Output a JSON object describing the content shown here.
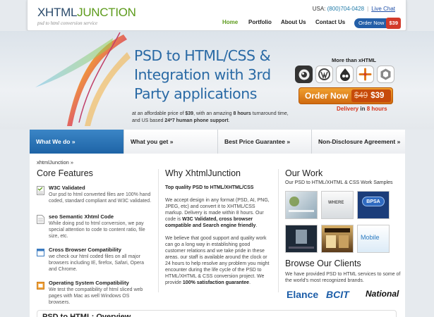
{
  "header": {
    "logo_main": "XHTML",
    "logo_accent": "JUNCTION",
    "logo_tagline": "psd to html conversion service",
    "contact_prefix": "USA:",
    "phone": "(800)704-0428",
    "separator": "|",
    "live_chat": "Live Chat",
    "nav": [
      "Home",
      "Portfolio",
      "About Us",
      "Contact Us"
    ],
    "order_label": "Order Now",
    "order_price": "$39"
  },
  "hero": {
    "title": "PSD to HTML/CSS & Integration with 3rd Party applications",
    "subtitle_start": "at an affordable price of ",
    "subtitle_price": "$39",
    "subtitle_mid": ", with an amazing ",
    "subtitle_hours": "8 hours",
    "subtitle_mid2": " turnaround time, and US based ",
    "subtitle_support": "24*7 human phone support",
    "subtitle_end": ".",
    "more_than": "More than xHTML",
    "cms_icons": [
      "drupal-icon",
      "wordpress-icon",
      "drupal-drop-icon",
      "joomla-icon",
      "magento-icon"
    ],
    "order_label": "Order Now",
    "old_price": "$49",
    "new_price": "$39",
    "delivery_prefix": "Delivery",
    "delivery_in": " in ",
    "delivery_hours": "8 hours"
  },
  "tabs": [
    "What We do »",
    "What you get »",
    "Best Price Guarantee »",
    "Non-Disclosure Agreement »"
  ],
  "breadcrumb": "xhtmlJunction  »",
  "core_features": {
    "heading": "Core Features",
    "items": [
      {
        "title": "W3C Validated",
        "text": "Our psd to html converted files are 100% hand coded, standard compliant and W3C validated."
      },
      {
        "title": "seo Semantic Xhtml Code",
        "text": "While doing psd to html conversion, we pay special attention to code to content ratio, file size, etc."
      },
      {
        "title": "Cross Browser Compatibility",
        "text": "we check our html coded files on all major browsers including IE, firefox, Safari, Opera and Chrome."
      },
      {
        "title": "Operating System Compatibility",
        "text": "We test the compatibility of html sliced web pages with Mac as well Windows OS browsers."
      }
    ]
  },
  "why": {
    "heading": "Why XhtmlJunction",
    "lead": "Top quality PSD to HTML/XHTML/CSS",
    "p1_start": "We accept design in any format (PSD, AI, PNG, JPEG, etc) and convert it to XHTML/CSS markup. Delivery is made within 8 hours. Our code is ",
    "p1_bold": "W3C Validated, cross browser compatible and Search engine friendly",
    "p1_end": ".",
    "p2_start": "We believe that good support and quality work can go a long way in establishing good customer relations and we take pride in these areas. our staff is available around the clock or 24 hours to help resolve any problem you might encounter during the life cycle of the PSD to HTML/XHTML & CSS conversion project. We provide ",
    "p2_bold": "100% satisfaction guarantee",
    "p2_end": "."
  },
  "work": {
    "heading": "Our Work",
    "subtitle": "Our PSD to HTML/XHTML & CSS Work Samples",
    "thumbs": [
      "",
      "WHERE",
      "BPSA",
      "",
      "",
      "Mobile"
    ]
  },
  "clients": {
    "heading": "Browse Our Clients",
    "text": "We have provided PSD to HTML services to some of the world's most recognized brands.",
    "logos": [
      "Elance",
      "BCIT",
      "National"
    ]
  },
  "overview": "PSD to HTML: Overview",
  "colors": {
    "brand_blue": "#2a6aa5",
    "brand_green": "#5d9b1c",
    "order_orange": "#e0801c",
    "price_red": "#d23a2a"
  }
}
